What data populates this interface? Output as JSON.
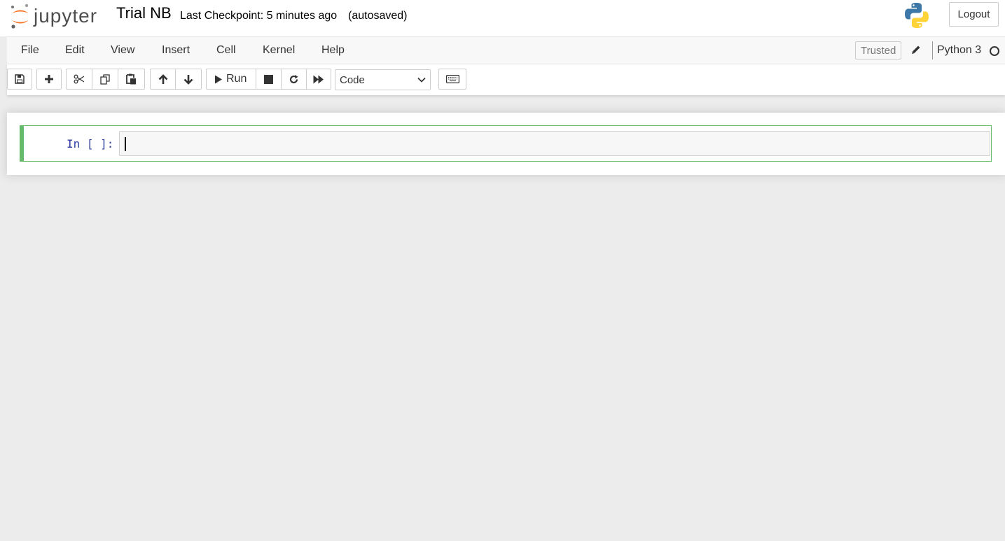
{
  "header": {
    "logo_text": "jupyter",
    "notebook_title": "Trial NB",
    "checkpoint": "Last Checkpoint: 5 minutes ago",
    "autosave_status": "(autosaved)",
    "logout_label": "Logout"
  },
  "menubar": {
    "items": [
      "File",
      "Edit",
      "View",
      "Insert",
      "Cell",
      "Kernel",
      "Help"
    ],
    "trusted_label": "Trusted",
    "kernel_name": "Python 3"
  },
  "toolbar": {
    "run_label": "Run",
    "cell_type": "Code"
  },
  "cell": {
    "prompt": "In [ ]:",
    "input": ""
  },
  "colors": {
    "cell_active_border": "#66bb6a",
    "prompt": "#303f9f",
    "logo_orange": "#f37726"
  }
}
